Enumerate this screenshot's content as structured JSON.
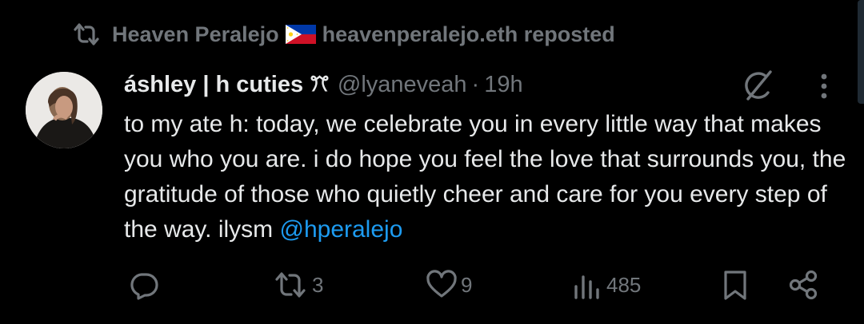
{
  "repost": {
    "text": "Heaven Peralejo",
    "flag_icon": "philippines-flag-icon",
    "handle_text": "heavenperalejo.eth reposted"
  },
  "tweet": {
    "display_name": "áshley | h cuties",
    "name_emoji": "ꔫ",
    "handle": "@lyaneveah",
    "separator": "·",
    "time": "19h",
    "text_before_mention": "to my ate h: today, we celebrate you in every little way that makes you who you are. i do hope you feel the love that surrounds you, the gratitude of those who quietly cheer and care for you every step of the way. ilysm ",
    "mention": "@hperalejo"
  },
  "actions": {
    "reply_count": "",
    "repost_count": "3",
    "like_count": "9",
    "views_count": "485"
  },
  "colors": {
    "background": "#000000",
    "text": "#e7e9ea",
    "muted": "#71767b",
    "link": "#1d9bf0"
  }
}
